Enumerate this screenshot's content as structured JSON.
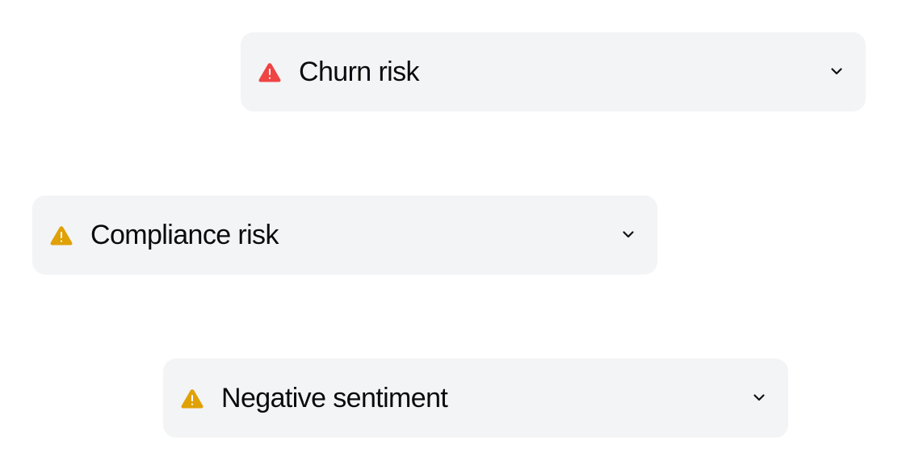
{
  "alerts": [
    {
      "label": "Churn risk",
      "icon": "warning-triangle-icon",
      "color": "#ef4444"
    },
    {
      "label": "Compliance risk",
      "icon": "warning-triangle-icon",
      "color": "#e0a106"
    },
    {
      "label": "Negative sentiment",
      "icon": "warning-triangle-icon",
      "color": "#e0a106"
    }
  ],
  "colors": {
    "card_background": "#f3f4f6",
    "text": "#0b0b0b"
  }
}
